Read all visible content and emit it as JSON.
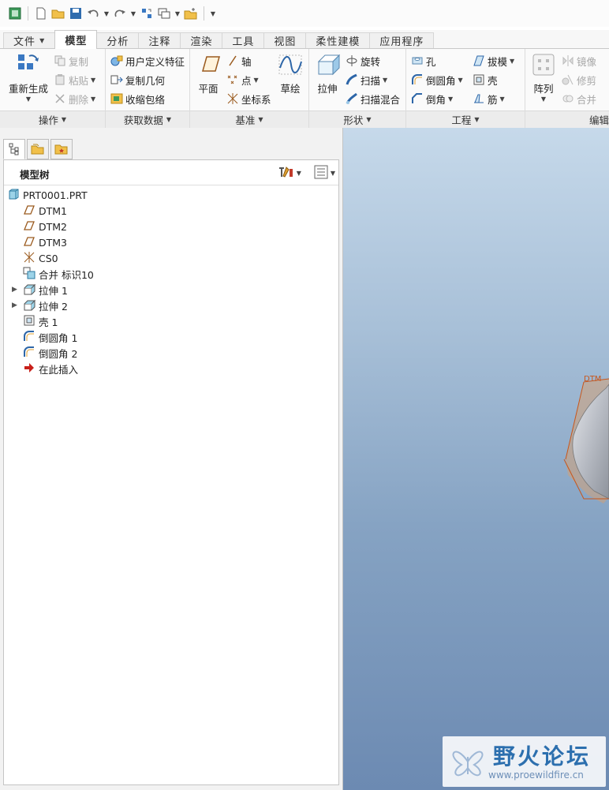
{
  "tabs": [
    "文件",
    "模型",
    "分析",
    "注释",
    "渲染",
    "工具",
    "视图",
    "柔性建模",
    "应用程序"
  ],
  "ribbon": {
    "operations": {
      "regenerate": "重新生成",
      "copy": "复制",
      "paste": "粘贴",
      "delete": "删除",
      "footer": "操作"
    },
    "get_data": {
      "udf": "用户定义特征",
      "copy_geom": "复制几何",
      "shrinkwrap": "收缩包络",
      "footer": "获取数据"
    },
    "datum": {
      "plane": "平面",
      "axis": "轴",
      "point": "点",
      "csys": "坐标系",
      "sketch": "草绘",
      "footer": "基准"
    },
    "shapes": {
      "extrude": "拉伸",
      "revolve": "旋转",
      "sweep": "扫描",
      "swept_blend": "扫描混合",
      "footer": "形状"
    },
    "engineering": {
      "hole": "孔",
      "round": "倒圆角",
      "chamfer": "倒角",
      "draft": "拔模",
      "shell": "壳",
      "rib": "筋",
      "footer": "工程"
    },
    "editing": {
      "pattern": "阵列",
      "mirror": "镜像",
      "trim": "修剪",
      "merge": "合并",
      "footer": "编辑"
    }
  },
  "model_tree": {
    "title": "模型树",
    "items": [
      {
        "label": "PRT0001.PRT",
        "icon": "part-icon",
        "expandable": false
      },
      {
        "label": "DTM1",
        "icon": "datum-plane-icon",
        "expandable": false
      },
      {
        "label": "DTM2",
        "icon": "datum-plane-icon",
        "expandable": false
      },
      {
        "label": "DTM3",
        "icon": "datum-plane-icon",
        "expandable": false
      },
      {
        "label": "CS0",
        "icon": "csys-icon",
        "expandable": false
      },
      {
        "label": "合并 标识10",
        "icon": "merge-icon",
        "expandable": false
      },
      {
        "label": "拉伸 1",
        "icon": "extrude-icon",
        "expandable": true
      },
      {
        "label": "拉伸 2",
        "icon": "extrude-icon",
        "expandable": true
      },
      {
        "label": "壳 1",
        "icon": "shell-icon",
        "expandable": false
      },
      {
        "label": "倒圆角 1",
        "icon": "round-icon",
        "expandable": false
      },
      {
        "label": "倒圆角 2",
        "icon": "round-icon",
        "expandable": false
      },
      {
        "label": "在此插入",
        "icon": "insert-here-icon",
        "expandable": false
      }
    ]
  },
  "graphics": {
    "datum_label": "DTM"
  },
  "watermark": {
    "brand": "野火论坛",
    "url": "www.proewildfire.cn"
  }
}
